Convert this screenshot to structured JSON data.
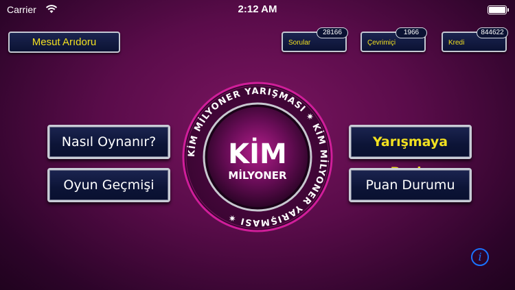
{
  "status_bar": {
    "carrier": "Carrier",
    "time": "2:12 AM"
  },
  "user": {
    "name": "Mesut Arıdoru"
  },
  "stats": [
    {
      "label": "Sorular",
      "value": "28166"
    },
    {
      "label": "Çevrimiçi",
      "value": "1966"
    },
    {
      "label": "Kredi",
      "value": "844622"
    }
  ],
  "menu": {
    "how_to_play": "Nasıl Oynanır?",
    "history": "Oyun Geçmişi",
    "start": "Yarışmaya Başla",
    "scores": "Puan Durumu"
  },
  "logo": {
    "title": "KİM",
    "subtitle": "MİLYONER",
    "ring_text": "KİM MİLYONER YARIŞMASI ✷ KİM MİLYONER YARIŞMASI ✷ "
  },
  "info": {
    "glyph": "i"
  },
  "colors": {
    "accent_yellow": "#f2e020",
    "button_navy": "#0c1436",
    "info_blue": "#1a73ff"
  }
}
